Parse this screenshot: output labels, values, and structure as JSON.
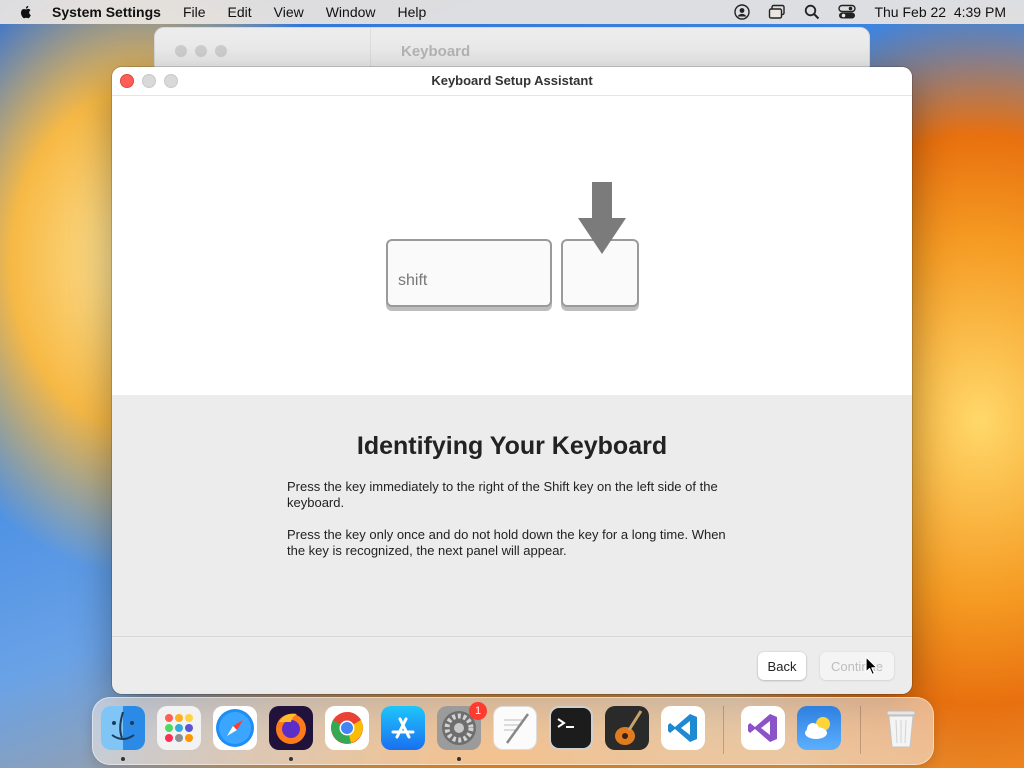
{
  "menubar": {
    "app_name": "System Settings",
    "menus": [
      "File",
      "Edit",
      "View",
      "Window",
      "Help"
    ],
    "clock": "Thu Feb 22  4:39 PM"
  },
  "background_window": {
    "title": "Keyboard"
  },
  "dialog": {
    "title": "Keyboard Setup Assistant",
    "shift_key_label": "shift",
    "heading": "Identifying Your Keyboard",
    "paragraph1": "Press the key immediately to the right of the Shift key on the left side of the keyboard.",
    "paragraph2": "Press the key only once and do not hold down the key for a long time. When the key is recognized, the next panel will appear.",
    "back_label": "Back",
    "continue_label": "Continue"
  },
  "dock": {
    "apps": [
      {
        "name": "finder-icon",
        "running": true
      },
      {
        "name": "launchpad-icon",
        "running": false
      },
      {
        "name": "safari-icon",
        "running": false
      },
      {
        "name": "firefox-icon",
        "running": true
      },
      {
        "name": "chrome-icon",
        "running": false
      },
      {
        "name": "app-store-icon",
        "running": false
      },
      {
        "name": "system-settings-icon",
        "running": true,
        "badge": "1"
      },
      {
        "name": "textedit-icon",
        "running": false
      },
      {
        "name": "terminal-icon",
        "running": false
      },
      {
        "name": "garageband-icon",
        "running": false
      },
      {
        "name": "vscode-icon",
        "running": false
      },
      {
        "name": "visual-studio-icon",
        "running": false
      },
      {
        "name": "weather-icon",
        "running": false
      },
      {
        "name": "trash-icon",
        "running": false
      }
    ]
  },
  "colors": {
    "close_light": "#ff5f57",
    "badge": "#ff3b30",
    "arrow": "#7b7b7b"
  }
}
